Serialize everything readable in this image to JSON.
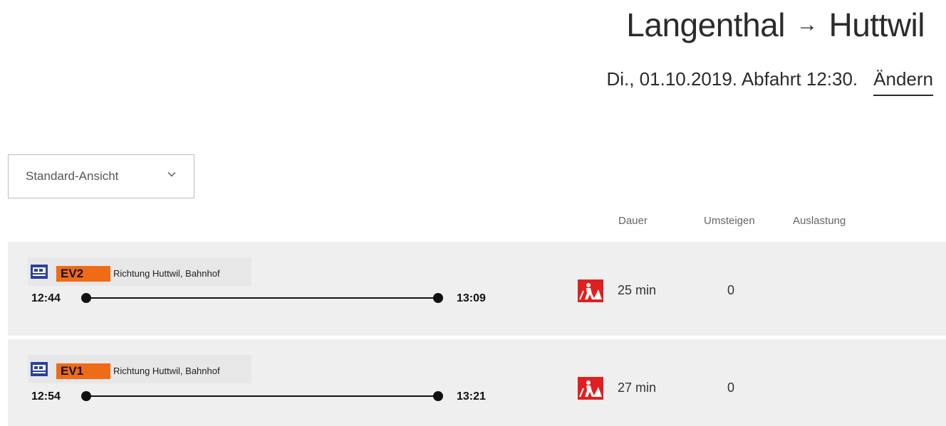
{
  "header": {
    "origin": "Langenthal",
    "arrow": "→",
    "destination": "Huttwil",
    "date_line": "Di., 01.10.2019. Abfahrt 12:30.",
    "change_label": "Ändern"
  },
  "filter": {
    "view_label": "Standard-Ansicht",
    "icon": "chevron-down-icon"
  },
  "columns": {
    "duration": "Dauer",
    "changes": "Umsteigen",
    "occupancy": "Auslastung"
  },
  "connections": [
    {
      "line": "EV2",
      "direction": "Richtung Huttwil, Bahnhof",
      "departure": "12:44",
      "arrival": "13:09",
      "duration": "25 min",
      "changes": "0",
      "badge_color": "#f06b16",
      "icons": [
        "bus-icon",
        "construction-warning-icon"
      ]
    },
    {
      "line": "EV1",
      "direction": "Richtung Huttwil, Bahnhof",
      "departure": "12:54",
      "arrival": "13:21",
      "duration": "27 min",
      "changes": "0",
      "badge_color": "#f06b16",
      "icons": [
        "bus-icon",
        "construction-warning-icon"
      ]
    }
  ]
}
